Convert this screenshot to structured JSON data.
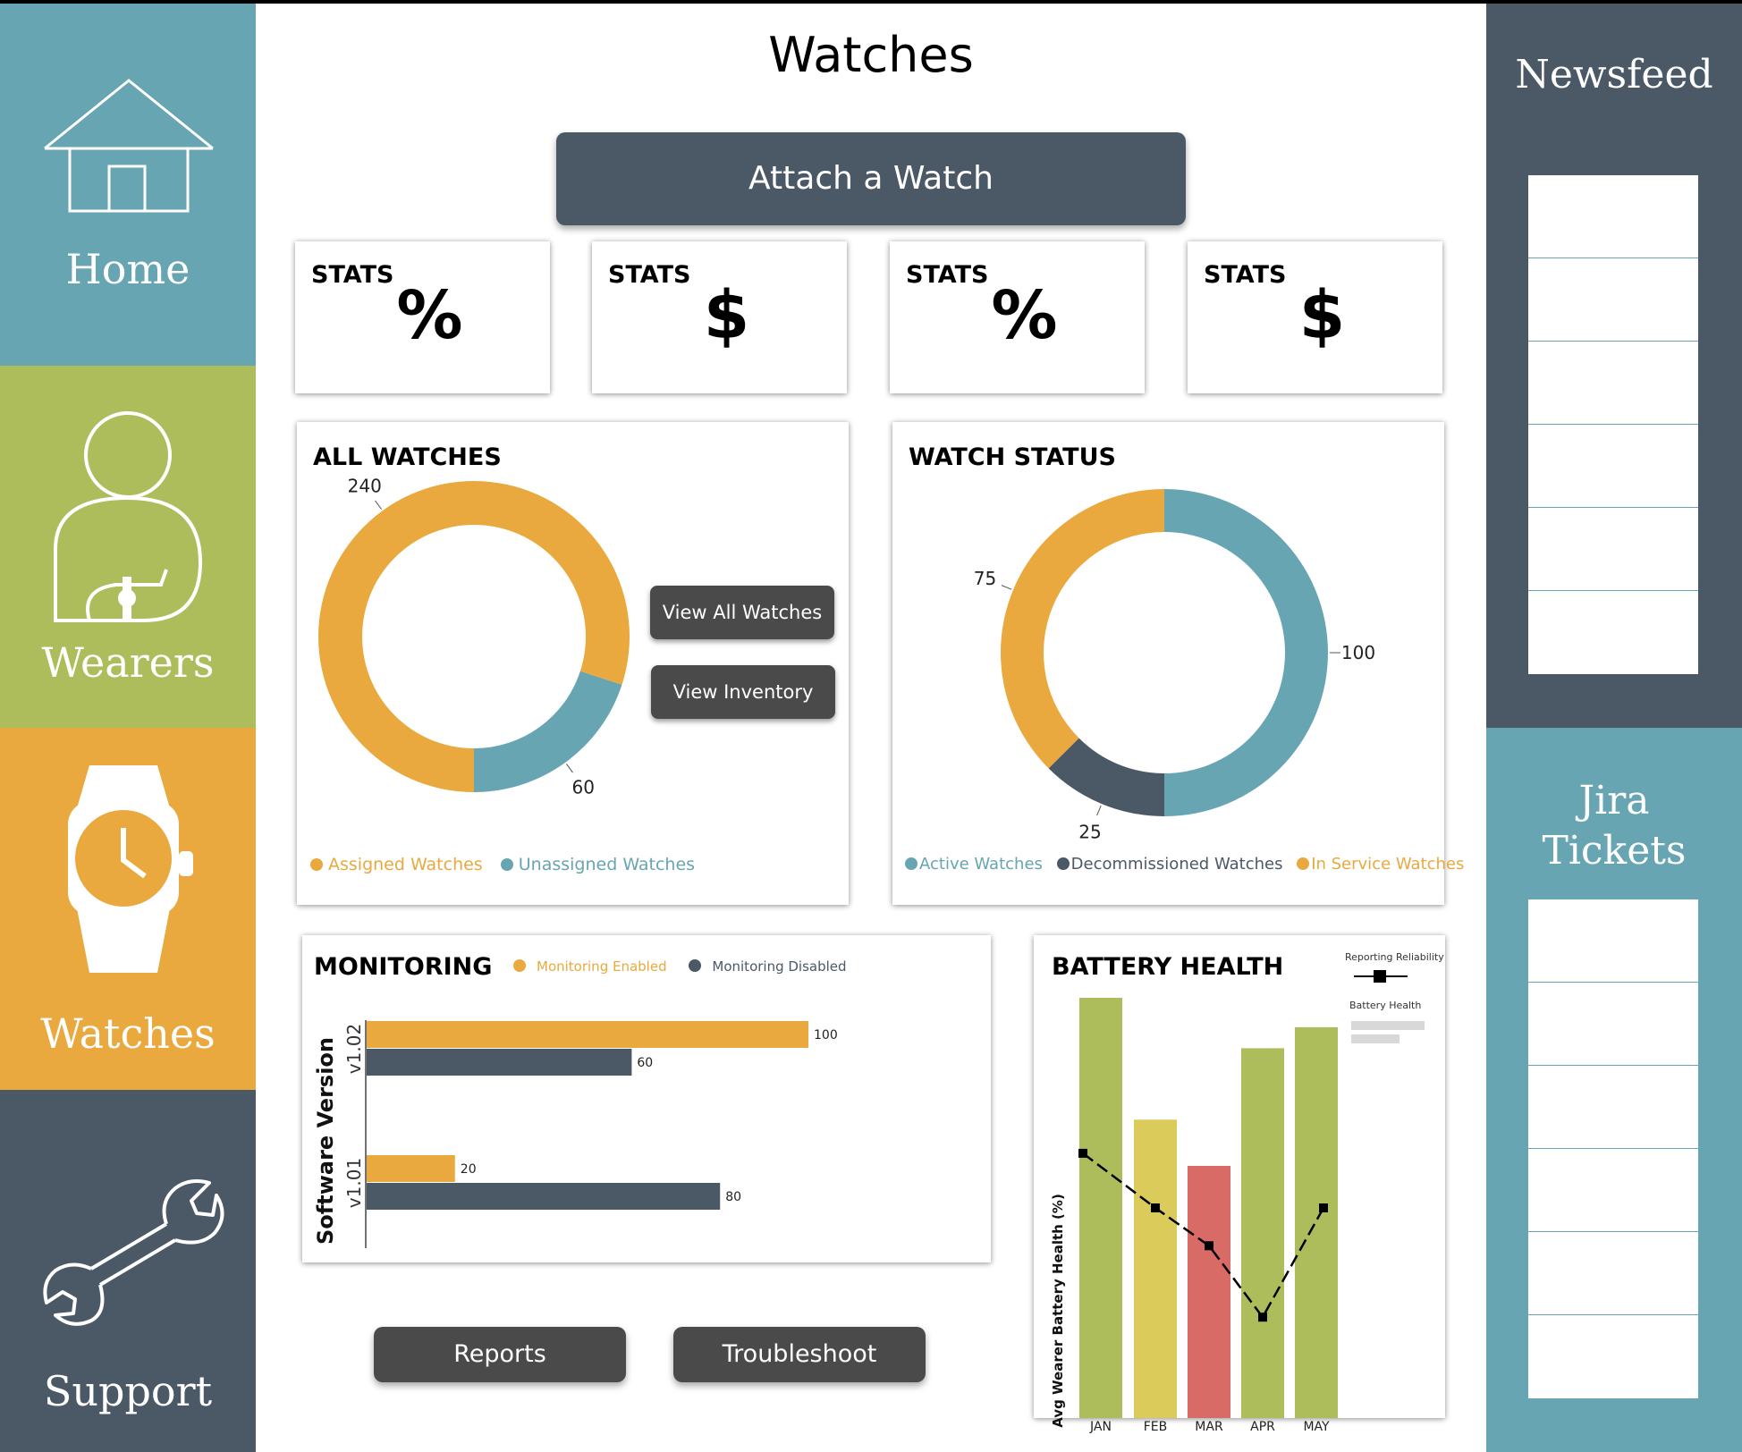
{
  "nav": {
    "items": [
      {
        "label": "Home",
        "icon": "home-icon"
      },
      {
        "label": "Wearers",
        "icon": "wearer-icon"
      },
      {
        "label": "Watches",
        "icon": "watch-icon"
      },
      {
        "label": "Support",
        "icon": "wrench-icon"
      }
    ]
  },
  "header": {
    "title": "Watches",
    "attach_label": "Attach a Watch"
  },
  "stats": [
    {
      "label": "STATS",
      "symbol": "%"
    },
    {
      "label": "STATS",
      "symbol": "$"
    },
    {
      "label": "STATS",
      "symbol": "%"
    },
    {
      "label": "STATS",
      "symbol": "$"
    }
  ],
  "newsfeed": {
    "title": "Newsfeed"
  },
  "jira": {
    "title_line1": "Jira",
    "title_line2": "Tickets"
  },
  "buttons": {
    "view_all": "View All Watches",
    "view_inventory": "View Inventory",
    "reports": "Reports",
    "troubleshoot": "Troubleshoot"
  },
  "colors": {
    "orange": "#e9a93e",
    "teal": "#67a5b2",
    "slate": "#4b5866",
    "green": "#adbd5c",
    "yellow": "#dacb5a",
    "red": "#d96b66"
  },
  "chart_data": [
    {
      "id": "all_watches",
      "type": "pie",
      "title": "ALL WATCHES",
      "series": [
        {
          "name": "Assigned Watches",
          "value": 240,
          "color": "#e9a93e"
        },
        {
          "name": "Unassigned Watches",
          "value": 60,
          "color": "#67a5b2"
        }
      ],
      "slice_labels": [
        "240",
        "60"
      ]
    },
    {
      "id": "watch_status",
      "type": "pie",
      "title": "WATCH STATUS",
      "series": [
        {
          "name": "Active Watches",
          "value": 100,
          "color": "#67a5b2"
        },
        {
          "name": "Decommissioned Watches",
          "value": 25,
          "color": "#4b5866"
        },
        {
          "name": "In Service Watches",
          "value": 75,
          "color": "#e9a93e"
        }
      ],
      "slice_labels": [
        "100",
        "25",
        "75"
      ]
    },
    {
      "id": "monitoring",
      "type": "bar",
      "orientation": "horizontal",
      "title": "MONITORING",
      "ylabel": "Software Version",
      "categories": [
        "v1.02",
        "v1.01"
      ],
      "series": [
        {
          "name": "Monitoring Enabled",
          "values": [
            100,
            20
          ],
          "color": "#e9a93e"
        },
        {
          "name": "Monitoring Disabled",
          "values": [
            60,
            80
          ],
          "color": "#4b5866"
        }
      ],
      "value_labels": [
        [
          "100",
          "20"
        ],
        [
          "60",
          "80"
        ]
      ],
      "xlim": [
        0,
        115
      ]
    },
    {
      "id": "battery_health",
      "type": "bar",
      "title": "BATTERY HEALTH",
      "ylabel": "Avg Wearer Battery Health (%)",
      "categories": [
        "JAN",
        "FEB",
        "MAR",
        "APR",
        "MAY"
      ],
      "values": [
        100,
        71,
        60,
        88,
        93
      ],
      "bar_colors": [
        "#adbd5c",
        "#dacb5a",
        "#d96b66",
        "#adbd5c",
        "#adbd5c"
      ],
      "line": {
        "name": "Reporting Reliability",
        "values": [
          63,
          50,
          41,
          24,
          50
        ]
      },
      "legend": {
        "line_label": "Reporting  Reliability",
        "bar_label": "Battery Health"
      },
      "ylim": [
        0,
        100
      ]
    }
  ]
}
